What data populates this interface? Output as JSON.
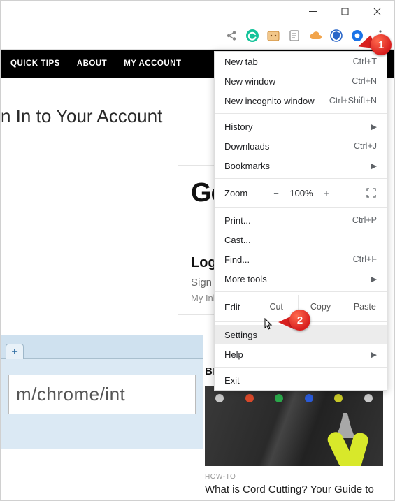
{
  "window_controls": {
    "min": "minimize-icon",
    "max": "maximize-icon",
    "close": "close-icon"
  },
  "extensions": [
    {
      "name": "share-icon",
      "color": "#7a7a7a"
    },
    {
      "name": "grammarly-icon",
      "color": "#15c39a"
    },
    {
      "name": "toast-icon",
      "color": "#f2a44b"
    },
    {
      "name": "notes-icon",
      "color": "#9a9a9a"
    },
    {
      "name": "cloud-icon",
      "color": "#f2a44b"
    },
    {
      "name": "shield-icon",
      "color": "#2a66c8"
    },
    {
      "name": "circle-icon",
      "color": "#1a73e8"
    }
  ],
  "nav": [
    "QUICK TIPS",
    "ABOUT",
    "MY ACCOUNT"
  ],
  "page_heading": "n In to Your Account",
  "widget": {
    "brand": "Google",
    "login": "Login",
    "signin": "Sign In",
    "inbox": "My Inbox"
  },
  "thumb": {
    "url_text": "m/chrome/int",
    "plus": "+"
  },
  "sidebar": {
    "title": "BEST OF GROOVYPOST",
    "category": "HOW-TO",
    "article": "What is Cord Cutting? Your Guide to"
  },
  "callouts": {
    "one": "1",
    "two": "2"
  },
  "menu": {
    "new_tab": {
      "label": "New tab",
      "sc": "Ctrl+T"
    },
    "new_window": {
      "label": "New window",
      "sc": "Ctrl+N"
    },
    "incognito": {
      "label": "New incognito window",
      "sc": "Ctrl+Shift+N"
    },
    "history": {
      "label": "History"
    },
    "downloads": {
      "label": "Downloads",
      "sc": "Ctrl+J"
    },
    "bookmarks": {
      "label": "Bookmarks"
    },
    "zoom": {
      "label": "Zoom",
      "minus": "−",
      "value": "100%",
      "plus": "+"
    },
    "print": {
      "label": "Print...",
      "sc": "Ctrl+P"
    },
    "cast": {
      "label": "Cast..."
    },
    "find": {
      "label": "Find...",
      "sc": "Ctrl+F"
    },
    "more": {
      "label": "More tools"
    },
    "edit": {
      "label": "Edit",
      "cut": "Cut",
      "copy": "Copy",
      "paste": "Paste"
    },
    "settings": {
      "label": "Settings"
    },
    "help": {
      "label": "Help"
    },
    "exit": {
      "label": "Exit"
    }
  }
}
